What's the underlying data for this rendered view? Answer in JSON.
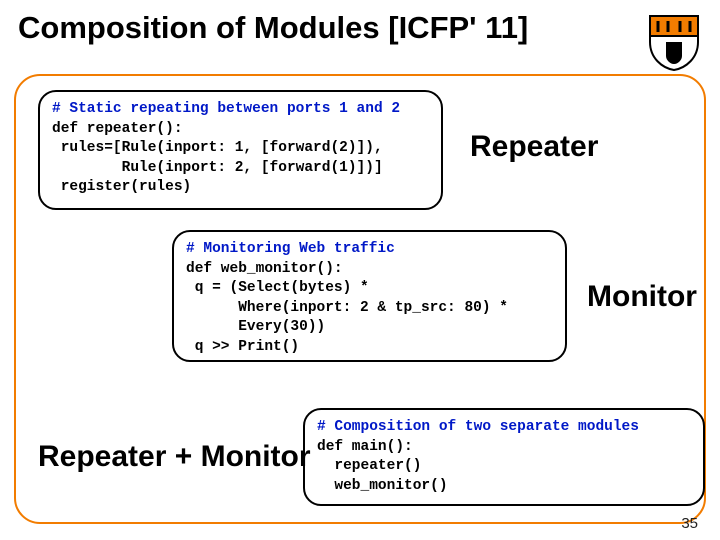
{
  "title": "Composition of Modules [ICFP' 11]",
  "page_number": "35",
  "labels": {
    "repeater": "Repeater",
    "monitor": "Monitor",
    "combo": "Repeater + Monitor"
  },
  "code": {
    "box1": {
      "l1": "# Static repeating between ports 1 and 2",
      "l2": "def repeater():",
      "l3": " rules=[Rule(inport: 1, [forward(2)]),",
      "l4": "        Rule(inport: 2, [forward(1)])]",
      "l5": " register(rules)"
    },
    "box2": {
      "l1": "# Monitoring Web traffic",
      "l2": "def web_monitor():",
      "l3": " q = (Select(bytes) *",
      "l4": "      Where(inport: 2 & tp_src: 80) *",
      "l5": "      Every(30))",
      "l6": " q >> Print()"
    },
    "box3": {
      "l1": "# Composition of two separate modules",
      "l2": "def main():",
      "l3": "  repeater()",
      "l4": "  web_monitor()"
    }
  }
}
